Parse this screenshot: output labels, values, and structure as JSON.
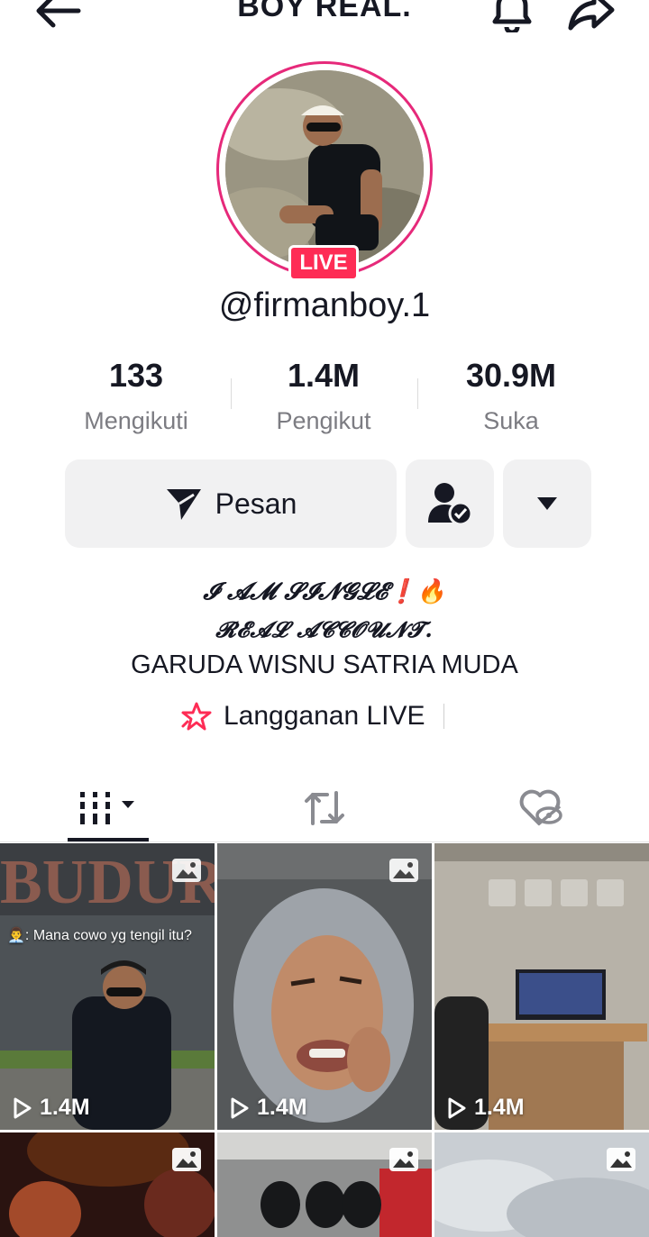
{
  "header": {
    "title": "BOY REAL.",
    "back_icon": "back-arrow-icon",
    "bell_icon": "bell-icon",
    "share_icon": "share-icon"
  },
  "profile": {
    "live_badge": "LIVE",
    "username": "@firmanboy.1",
    "ring_color": "#e6297a"
  },
  "stats": [
    {
      "value": "133",
      "label": "Mengikuti"
    },
    {
      "value": "1.4M",
      "label": "Pengikut"
    },
    {
      "value": "30.9M",
      "label": "Suka"
    }
  ],
  "actions": {
    "message_label": "Pesan",
    "message_icon": "send-icon",
    "friend_icon": "friend-check-icon",
    "more_icon": "dropdown-caret-icon"
  },
  "bio": {
    "line1": "𝓘 𝓐𝓜 𝓢𝓘𝓝𝓖𝓛𝓔❗🔥",
    "line2": "𝓡𝓔𝓐𝓛 𝓐𝓒𝓒𝓞𝓤𝓝𝓣.",
    "line3": "GARUDA WISNU SATRIA MUDA"
  },
  "subscribe": {
    "label": "Langganan LIVE",
    "icon": "star-sparkle-icon",
    "accent": "#fe2c55"
  },
  "tabs": [
    {
      "name": "videos",
      "icon": "grid-icon"
    },
    {
      "name": "reposts",
      "icon": "repost-icon"
    },
    {
      "name": "liked",
      "icon": "liked-hidden-icon"
    }
  ],
  "grid": [
    {
      "views": "1.4M",
      "caption": "👨‍💼: Mana cowo yg tengil itu?",
      "sign": "BUDUR"
    },
    {
      "views": "1.4M",
      "caption": ""
    },
    {
      "views": "1.4M",
      "caption": ""
    },
    {
      "views": "",
      "caption": ""
    },
    {
      "views": "",
      "caption": ""
    },
    {
      "views": "",
      "caption": ""
    }
  ]
}
